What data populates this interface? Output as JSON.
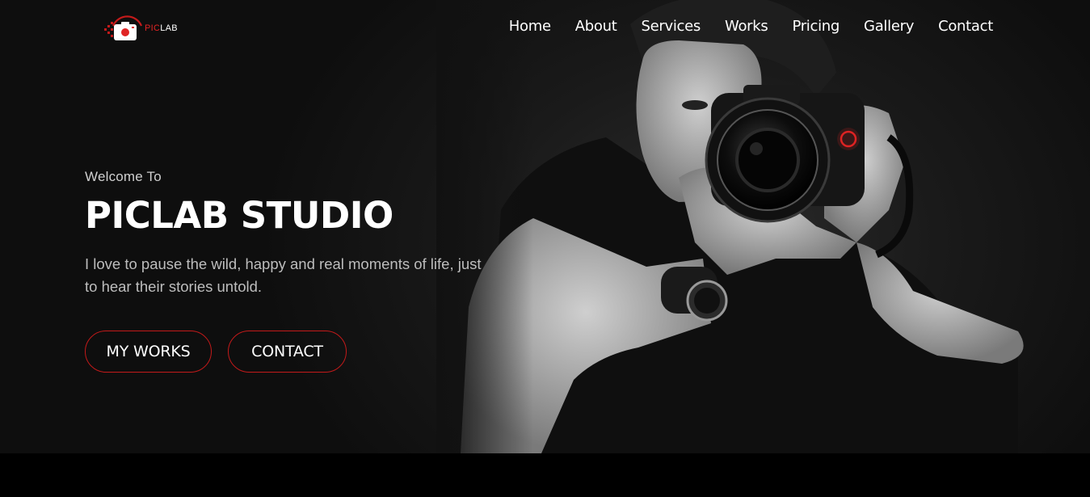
{
  "brand": {
    "logo_pic": "PIC",
    "logo_lab": "LAB",
    "accent_color": "#e02424"
  },
  "nav": {
    "items": [
      "Home",
      "About",
      "Services",
      "Works",
      "Pricing",
      "Gallery",
      "Contact"
    ]
  },
  "hero": {
    "welcome": "Welcome To",
    "title": "PICLAB STUDIO",
    "description": "I love to pause the wild, happy and real moments of life, just to hear their stories untold.",
    "buttons": {
      "works_label": "MY WORKS",
      "contact_label": "CONTACT"
    }
  },
  "icons": {
    "logo": "camera-icon",
    "photo": "photographer-image"
  }
}
